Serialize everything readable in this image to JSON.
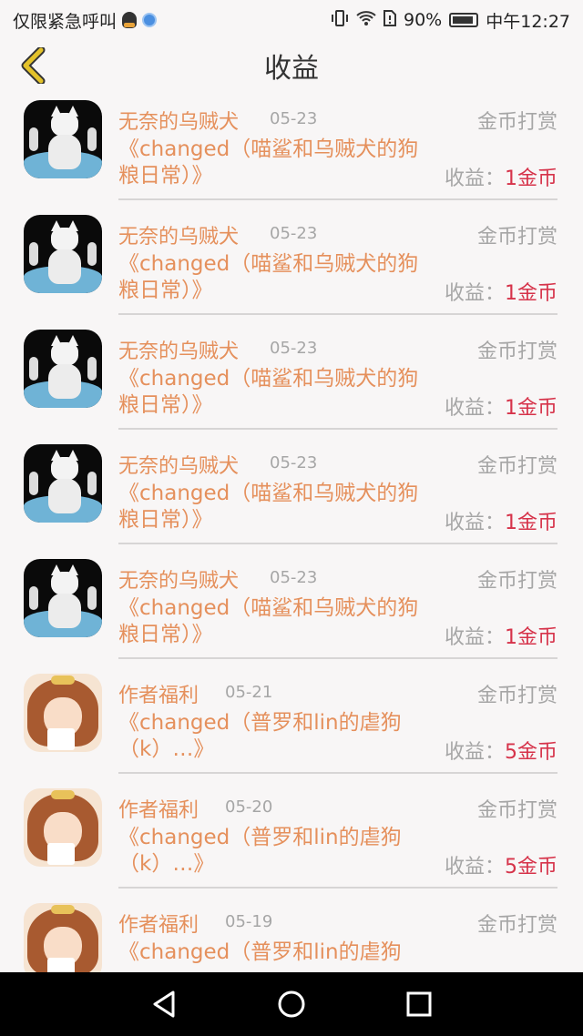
{
  "status_bar": {
    "carrier_text": "仅限紧急呼叫",
    "battery": "90%",
    "time": "中午12:27"
  },
  "header": {
    "title": "收益"
  },
  "income_label": "收益：",
  "items": [
    {
      "author": "无奈的乌贼犬",
      "date": "05-23",
      "type": "金币打赏",
      "book": "《changed（喵鲨和乌贼犬的狗粮日常）》",
      "amount": "1金币",
      "avatar": "cat"
    },
    {
      "author": "无奈的乌贼犬",
      "date": "05-23",
      "type": "金币打赏",
      "book": "《changed（喵鲨和乌贼犬的狗粮日常）》",
      "amount": "1金币",
      "avatar": "cat"
    },
    {
      "author": "无奈的乌贼犬",
      "date": "05-23",
      "type": "金币打赏",
      "book": "《changed（喵鲨和乌贼犬的狗粮日常）》",
      "amount": "1金币",
      "avatar": "cat"
    },
    {
      "author": "无奈的乌贼犬",
      "date": "05-23",
      "type": "金币打赏",
      "book": "《changed（喵鲨和乌贼犬的狗粮日常）》",
      "amount": "1金币",
      "avatar": "cat"
    },
    {
      "author": "无奈的乌贼犬",
      "date": "05-23",
      "type": "金币打赏",
      "book": "《changed（喵鲨和乌贼犬的狗粮日常）》",
      "amount": "1金币",
      "avatar": "cat"
    },
    {
      "author": "作者福利",
      "date": "05-21",
      "type": "金币打赏",
      "book": "《changed（普罗和lin的虐狗（k）…》",
      "amount": "5金币",
      "avatar": "girl"
    },
    {
      "author": "作者福利",
      "date": "05-20",
      "type": "金币打赏",
      "book": "《changed（普罗和lin的虐狗（k）…》",
      "amount": "5金币",
      "avatar": "girl"
    },
    {
      "author": "作者福利",
      "date": "05-19",
      "type": "金币打赏",
      "book": "《changed（普罗和lin的虐狗",
      "amount": "",
      "avatar": "girl"
    }
  ],
  "colors": {
    "accent": "#e5905c",
    "amount": "#d6334a",
    "muted": "#a6a6a6",
    "back_arrow": "#e3c22a"
  },
  "icons": {
    "back": "chevron-left-icon",
    "nav_back": "triangle-back-icon",
    "nav_home": "circle-home-icon",
    "nav_recent": "square-recent-icon"
  }
}
